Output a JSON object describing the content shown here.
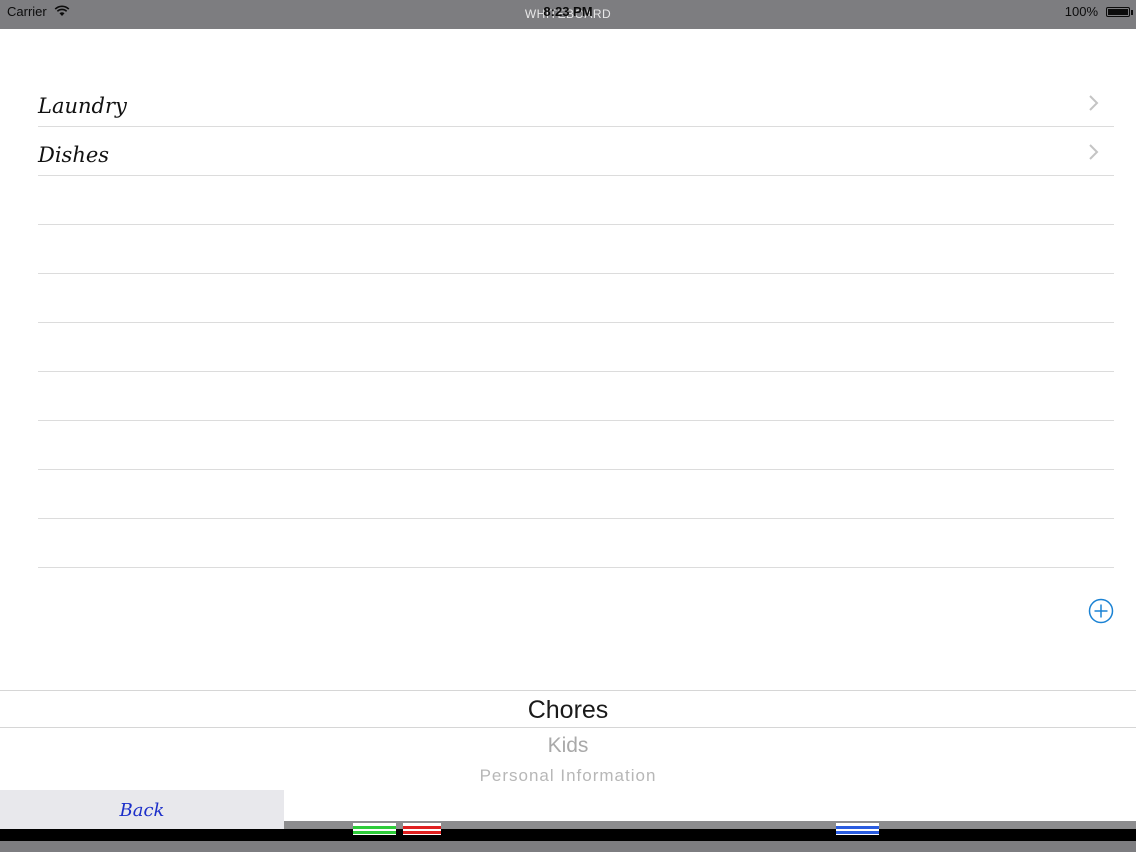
{
  "status_bar": {
    "carrier": "Carrier",
    "time": "8:23 PM",
    "title": "WHITEBOARD",
    "battery": "100%"
  },
  "list": {
    "items": [
      {
        "label": "Laundry"
      },
      {
        "label": "Dishes"
      }
    ],
    "add_icon": "plus-circle-icon",
    "chevron_icon": "chevron-right-icon"
  },
  "picker": {
    "options": [
      "Chores",
      "Kids",
      "Personal Information"
    ],
    "selected": "Chores"
  },
  "back_button": {
    "label": "Back"
  },
  "colors": {
    "accent": "#1a82d4",
    "back_text": "#1b2ec9",
    "marker_green": "#2ecc3a",
    "marker_red": "#e02020",
    "marker_blue": "#2a5ce0"
  }
}
